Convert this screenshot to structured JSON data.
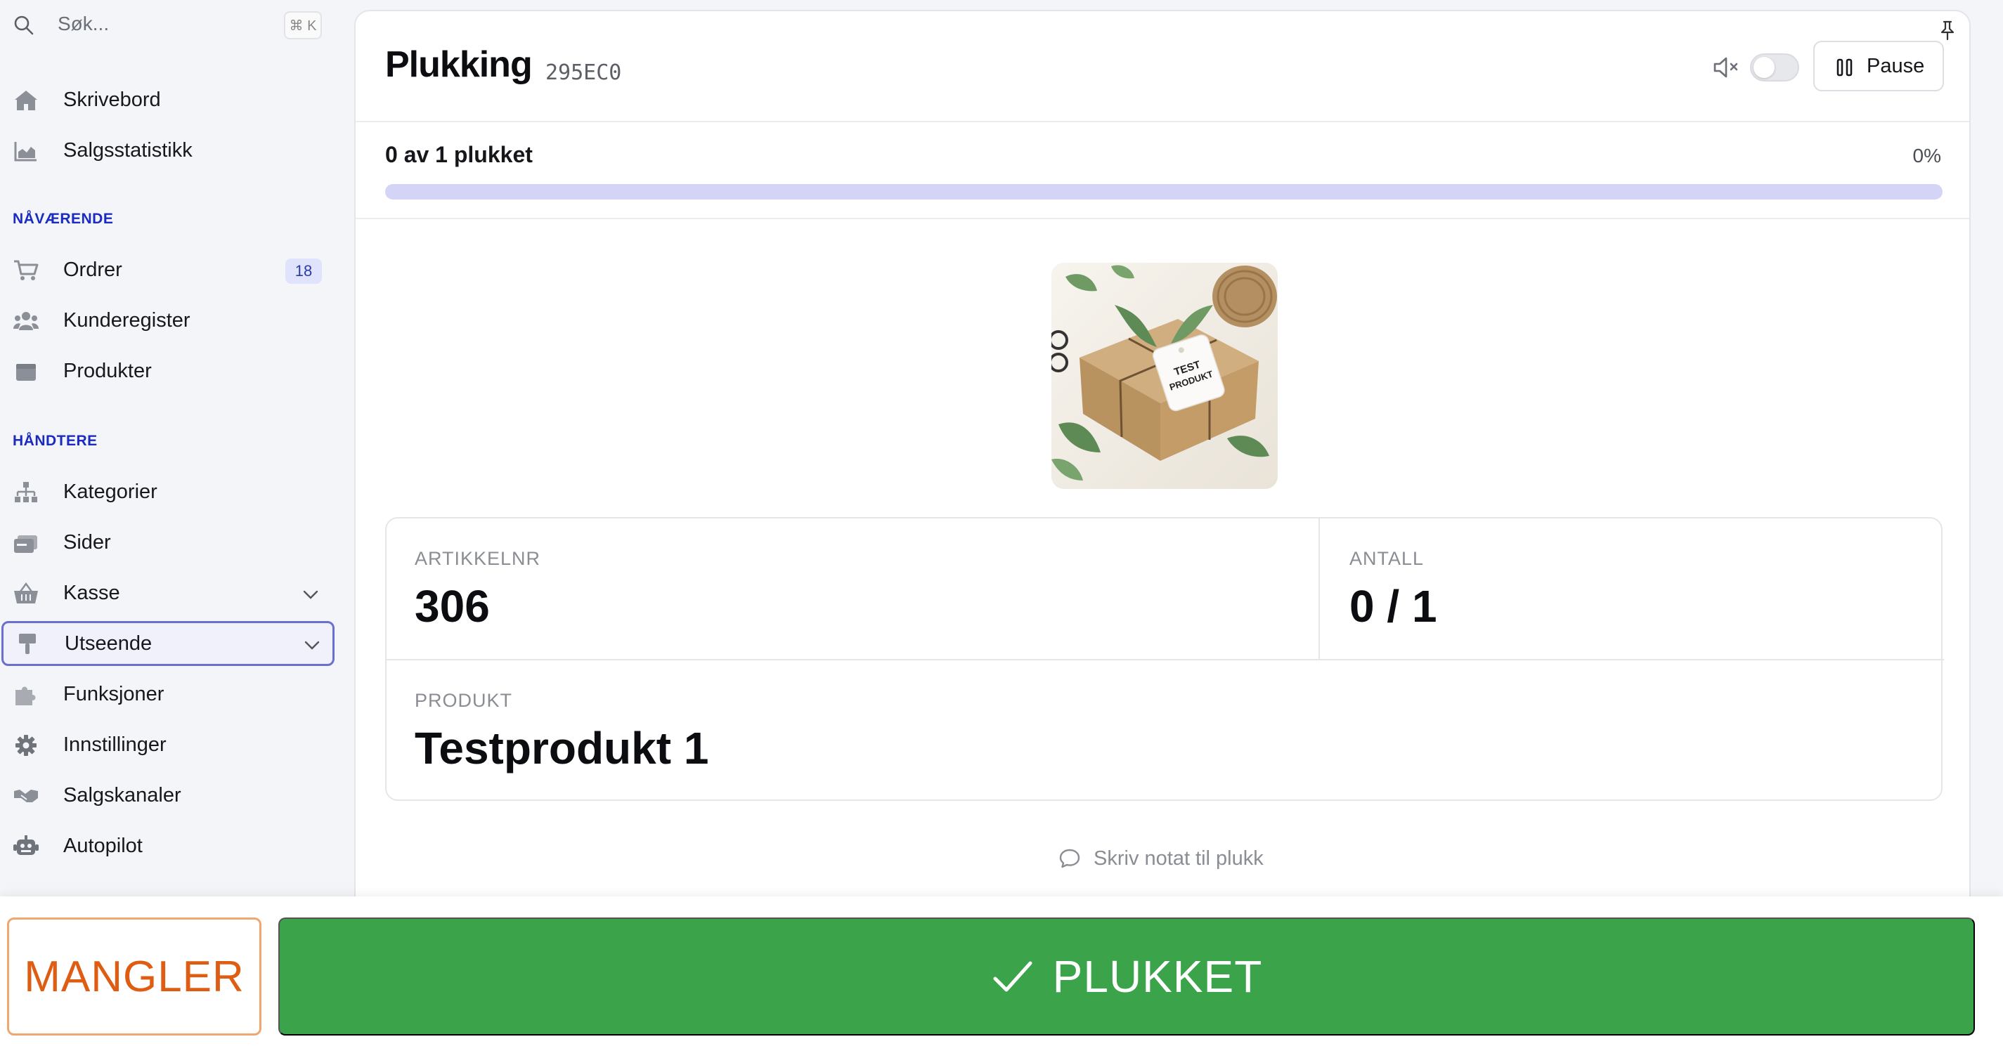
{
  "sidebar": {
    "search": {
      "placeholder": "Søk...",
      "shortcut": "⌘ K"
    },
    "top_items": [
      {
        "label": "Skrivebord",
        "icon": "home-icon"
      },
      {
        "label": "Salgsstatistikk",
        "icon": "chart-icon"
      }
    ],
    "sections": [
      {
        "title": "NÅVÆRENDE",
        "items": [
          {
            "label": "Ordrer",
            "icon": "cart-icon",
            "badge": "18"
          },
          {
            "label": "Kunderegister",
            "icon": "users-icon"
          },
          {
            "label": "Produkter",
            "icon": "box-icon"
          }
        ]
      },
      {
        "title": "HÅNDTERE",
        "items": [
          {
            "label": "Kategorier",
            "icon": "sitemap-icon"
          },
          {
            "label": "Sider",
            "icon": "pages-icon"
          },
          {
            "label": "Kasse",
            "icon": "basket-icon",
            "expandable": true
          },
          {
            "label": "Utseende",
            "icon": "brush-icon",
            "expandable": true,
            "active": true
          },
          {
            "label": "Funksjoner",
            "icon": "puzzle-icon"
          },
          {
            "label": "Innstillinger",
            "icon": "gear-icon"
          },
          {
            "label": "Salgskanaler",
            "icon": "handshake-icon"
          },
          {
            "label": "Autopilot",
            "icon": "robot-icon"
          }
        ]
      }
    ]
  },
  "header": {
    "title": "Plukking",
    "order_code": "295EC0",
    "mute_icon": "speaker-muted-icon",
    "sound_toggle": false,
    "pause_label": "Pause"
  },
  "progress": {
    "text": "0 av 1 plukket",
    "percent_label": "0%",
    "fraction": 0
  },
  "item": {
    "image_alt": "Testprodukt 1",
    "tag_text": "TEST PRODUKT",
    "article_label": "ARTIKKELNR",
    "article_value": "306",
    "quantity_label": "ANTALL",
    "quantity_value": "0 / 1",
    "product_label": "PRODUKT",
    "product_value": "Testprodukt 1"
  },
  "note": {
    "label": "Skriv notat til plukk"
  },
  "actions": {
    "missing_label": "MANGLER",
    "picked_label": "PLUKKET"
  },
  "colors": {
    "accent": "#5b5fd6",
    "picked": "#3ba34a",
    "missing": "#de5d12",
    "section_label": "#1b2bbf"
  }
}
